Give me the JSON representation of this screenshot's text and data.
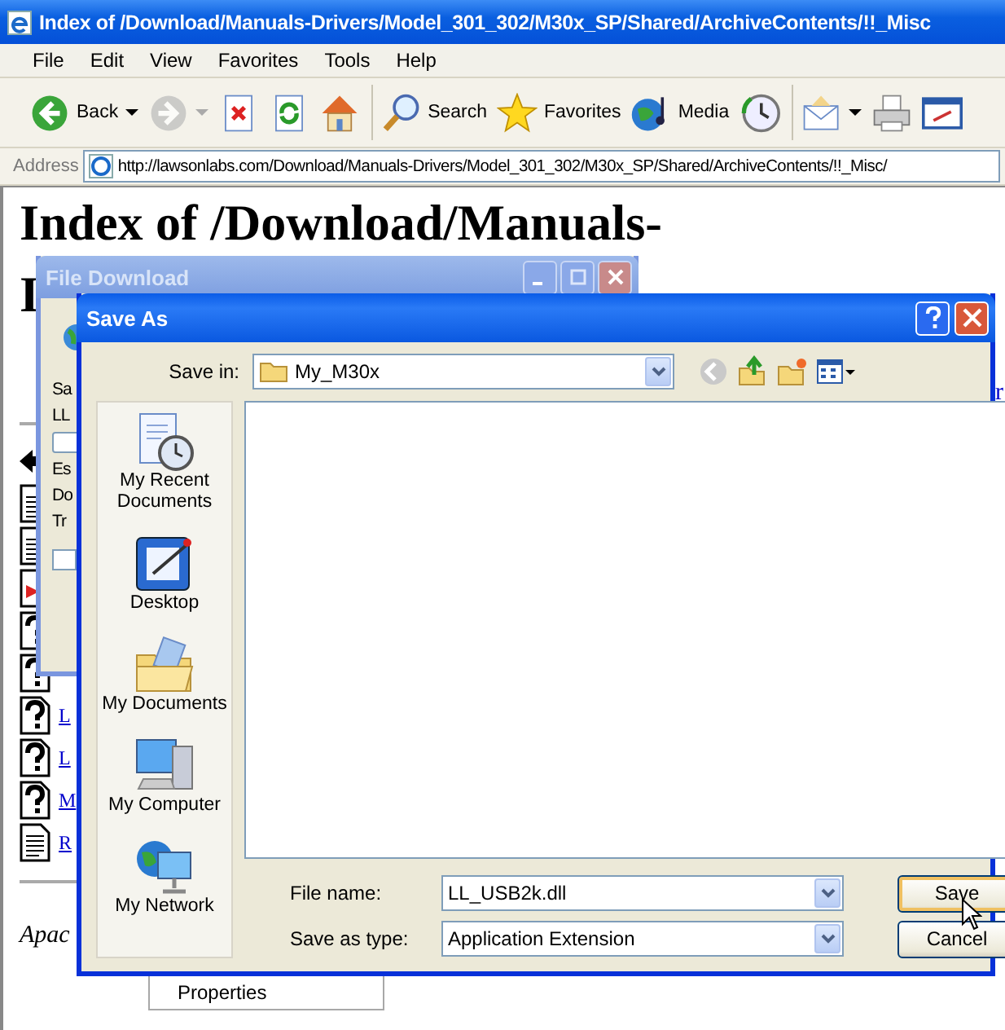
{
  "browser": {
    "title": "Index of /Download/Manuals-Drivers/Model_301_302/M30x_SP/Shared/ArchiveContents/!!_Misc",
    "menu": [
      "File",
      "Edit",
      "View",
      "Favorites",
      "Tools",
      "Help"
    ],
    "toolbar_groups": [
      [
        {
          "kind": "back",
          "label": "Back",
          "dropdown": true,
          "disabled": false
        },
        {
          "kind": "forward",
          "dropdown": true,
          "disabled": true
        },
        {
          "kind": "stop",
          "dropdown": false,
          "disabled": false
        },
        {
          "kind": "refresh",
          "dropdown": false,
          "disabled": false
        },
        {
          "kind": "home",
          "dropdown": false,
          "disabled": false
        }
      ],
      [
        {
          "kind": "search",
          "label": "Search",
          "dropdown": false,
          "disabled": false
        },
        {
          "kind": "favorites",
          "label": "Favorites",
          "dropdown": false,
          "disabled": false
        },
        {
          "kind": "media",
          "label": "Media",
          "dropdown": false,
          "disabled": false
        },
        {
          "kind": "history",
          "dropdown": false,
          "disabled": false
        }
      ],
      [
        {
          "kind": "mail",
          "dropdown": true,
          "disabled": false
        },
        {
          "kind": "print",
          "dropdown": false,
          "disabled": false
        },
        {
          "kind": "edit",
          "dropdown": false,
          "disabled": false
        }
      ]
    ],
    "address_label": "Address",
    "address": "http://lawsonlabs.com/Download/Manuals-Drivers/Model_301_302/M30x_SP/Shared/ArchiveContents/!!_Misc/"
  },
  "page": {
    "heading_line_1": "Index of /Download/Manuals-",
    "heading_line_2": "I",
    "right_fragment": "r",
    "rows": [
      {
        "kind": "back"
      },
      {
        "kind": "text"
      },
      {
        "kind": "text"
      },
      {
        "kind": "image"
      },
      {
        "kind": "unknown"
      },
      {
        "kind": "unknown"
      },
      {
        "kind": "unknown",
        "link": "L"
      },
      {
        "kind": "unknown",
        "link": "L"
      },
      {
        "kind": "unknown",
        "link": "M"
      },
      {
        "kind": "text",
        "link": "R"
      }
    ],
    "footer": "Apac"
  },
  "file_download": {
    "title": "File Download",
    "labels": [
      "Sa",
      "LL",
      "Es",
      "Do",
      "Tr"
    ],
    "checkbox": {
      "checked": false
    }
  },
  "save_as": {
    "title": "Save As",
    "save_in_label": "Save in:",
    "save_in": "My_M30x",
    "places": [
      {
        "kind": "recent",
        "label": "My Recent Documents"
      },
      {
        "kind": "desktop",
        "label": "Desktop"
      },
      {
        "kind": "documents",
        "label": "My Documents"
      },
      {
        "kind": "computer",
        "label": "My Computer"
      },
      {
        "kind": "network",
        "label": "My Network"
      }
    ],
    "file_name_label": "File name:",
    "file_name": "LL_USB2k.dll",
    "type_label": "Save as type:",
    "type": "Application Extension",
    "buttons": [
      {
        "label": "Save",
        "default": true
      },
      {
        "label": "Cancel",
        "default": false
      }
    ]
  },
  "context_menu": {
    "items": [
      "Properties"
    ]
  }
}
